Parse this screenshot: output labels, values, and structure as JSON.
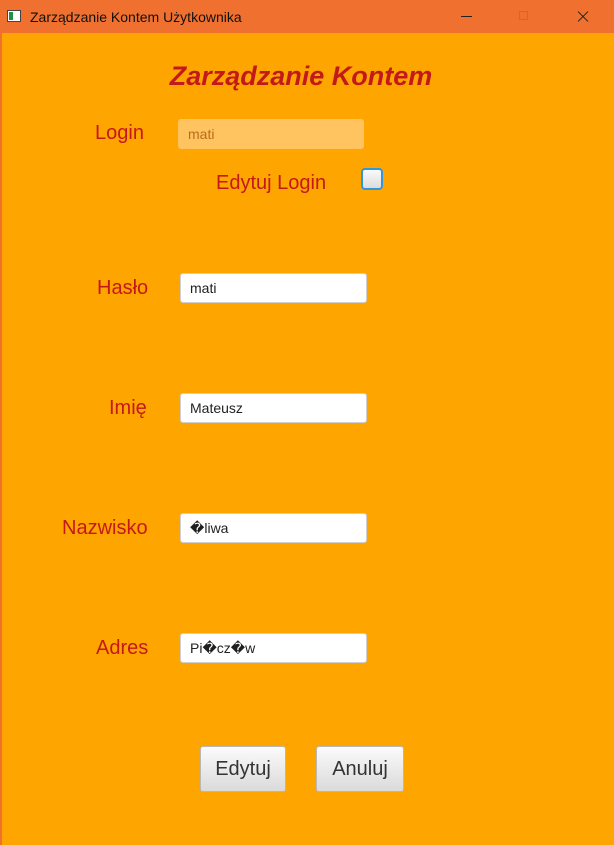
{
  "window": {
    "title": "Zarządzanie Kontem Użytkownika"
  },
  "form": {
    "heading": "Zarządzanie Kontem",
    "login_label": "Login",
    "login_value": "mati",
    "edit_login_label": "Edytuj Login",
    "edit_login_checked": false,
    "password_label": "Hasło",
    "password_value": "mati",
    "first_name_label": "Imię",
    "first_name_value": "Mateusz",
    "last_name_label": "Nazwisko",
    "last_name_value": "�liwa",
    "address_label": "Adres",
    "address_value": "Pi�cz�w"
  },
  "buttons": {
    "edit_label": "Edytuj",
    "cancel_label": "Anuluj"
  },
  "colors": {
    "titlebar": "#f07030",
    "background": "#ffa500",
    "label_text": "#c4191b",
    "disabled_input": "#ffc35f",
    "checkbox_border": "#3396d9"
  },
  "icons": {
    "app": "java-app-icon",
    "minimize": "minimize-icon",
    "maximize": "maximize-icon",
    "close": "close-icon"
  }
}
